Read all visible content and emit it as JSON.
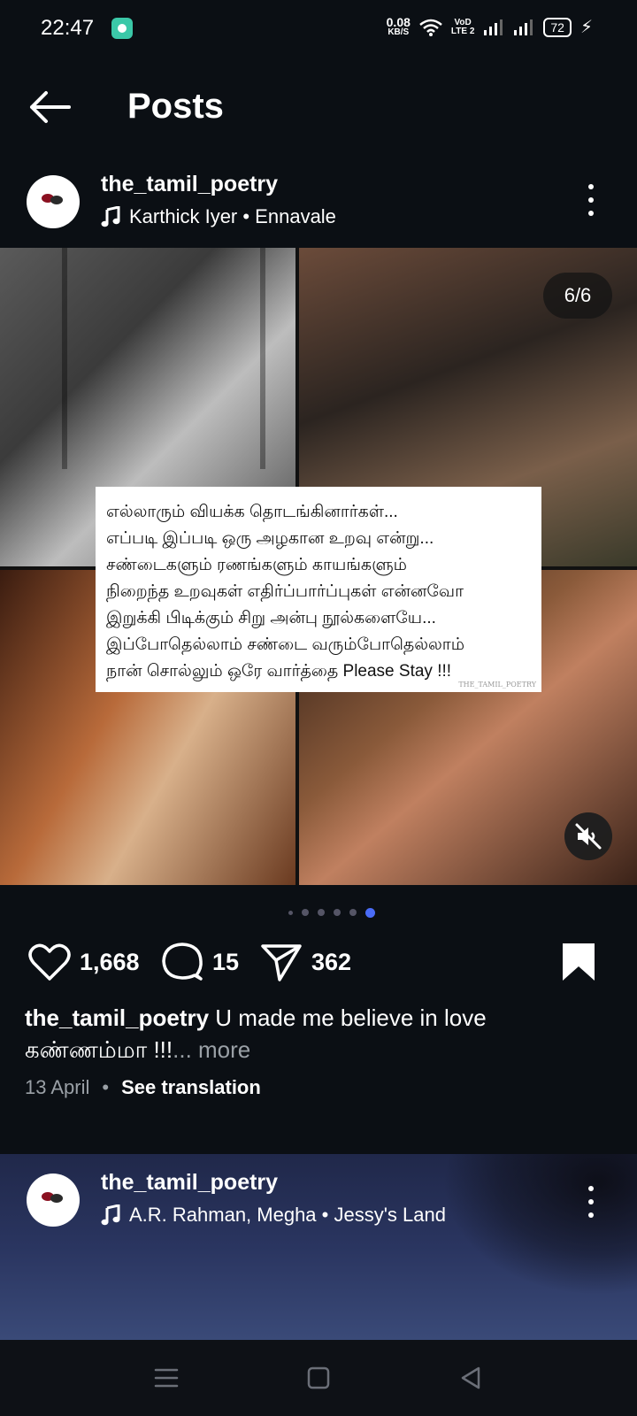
{
  "status_bar": {
    "time": "22:47",
    "net_speed": "0.08",
    "net_unit": "KB/S",
    "volte": "VoD",
    "volte_sub": "LTE 2",
    "battery": "72"
  },
  "header": {
    "title": "Posts"
  },
  "post1": {
    "username": "the_tamil_poetry",
    "music": "Karthick Iyer • Ennavale",
    "counter": "6/6",
    "poem_lines": [
      "எல்லாரும் வியக்க தொடங்கினார்கள்...",
      "எப்படி இப்படி ஒரு அழகான உறவு என்று...",
      "சண்டைகளும் ரணங்களும் காயங்களும்",
      "நிறைந்த உறவுகள் எதிர்ப்பார்ப்புகள் என்னவோ",
      "இறுக்கி பிடிக்கும் சிறு அன்பு நூல்களையே...",
      "இப்போதெல்லாம் சண்டை வரும்போதெல்லாம்",
      "நான் சொல்லும் ஒரே வார்த்தை Please Stay !!!"
    ],
    "watermark": "THE_TAMIL_POETRY",
    "likes": "1,668",
    "comments": "15",
    "shares": "362",
    "caption_user": "the_tamil_poetry",
    "caption_text": " U made me believe in love கண்ணம்மா !!!",
    "caption_more": "... more",
    "date": "13 April",
    "separator": "•",
    "see_translation": "See translation",
    "dots_count": 6,
    "active_dot": 6
  },
  "post2": {
    "username": "the_tamil_poetry",
    "music": "A.R. Rahman, Megha • Jessy's Land"
  },
  "icons": {
    "back": "arrow-left-icon",
    "music": "music-note-icon",
    "more": "more-vertical-icon",
    "mute": "volume-muted-icon",
    "like": "heart-icon",
    "comment": "comment-icon",
    "share": "send-icon",
    "save": "bookmark-icon"
  },
  "colors": {
    "background": "#0b0f14",
    "active_dot": "#4a6cf7",
    "muted_text": "#9aa0a6"
  }
}
